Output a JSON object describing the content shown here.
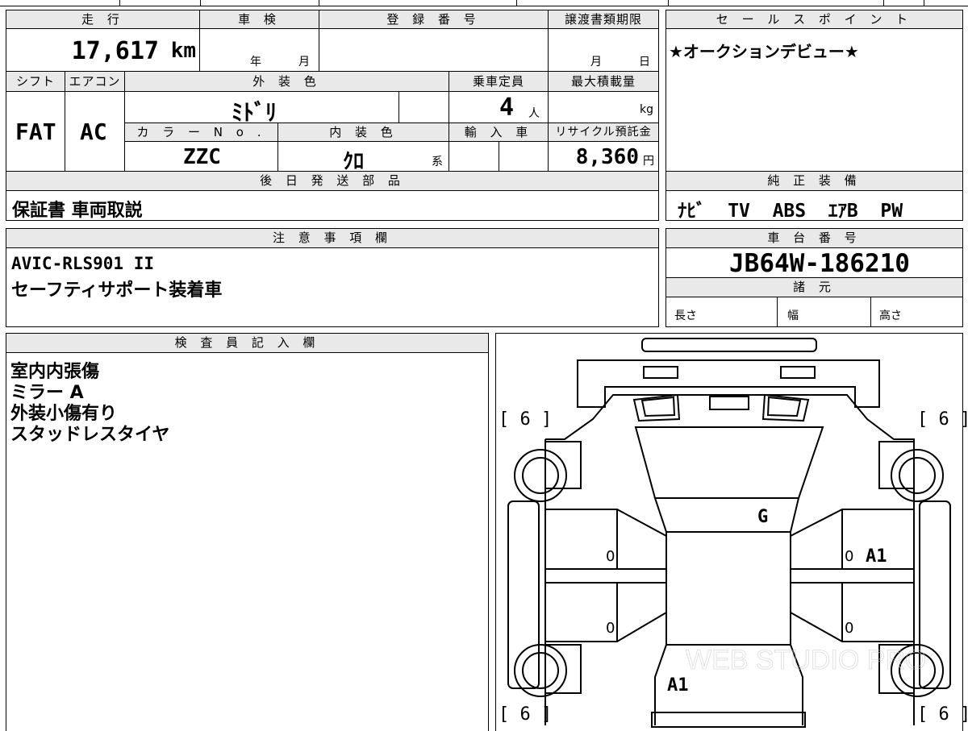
{
  "top_row": {
    "mileage_label": "走 行",
    "mileage_value": "17,617",
    "mileage_unit": "km",
    "inspection_label": "車 検",
    "inspection_year_unit": "年",
    "inspection_month_unit": "月",
    "registration_label": "登 録 番 号",
    "transfer_docs_label": "譲渡書類期限",
    "transfer_month_unit": "月",
    "transfer_day_unit": "日"
  },
  "vehicle": {
    "shift_label": "シフト",
    "shift_value": "FAT",
    "ac_label": "エアコン",
    "ac_value": "AC",
    "exterior_color_label": "外 装 色",
    "exterior_color_value": "ﾐﾄﾞﾘ",
    "capacity_label": "乗車定員",
    "capacity_value": "4",
    "capacity_unit": "人",
    "max_load_label": "最大積載量",
    "max_load_unit": "kg",
    "color_no_label": "カ ラ ー N o .",
    "color_no_value": "ZZC",
    "interior_color_label": "内 装 色",
    "interior_color_value": "ｸﾛ",
    "interior_color_suffix": "系",
    "import_label": "輸 入 車",
    "recycle_label": "リサイクル預託金",
    "recycle_value": "8,360",
    "recycle_unit": "円"
  },
  "sales_point": {
    "label": "セ ー ル ス ポ イ ン ト",
    "text": "★オークションデビュー★"
  },
  "later_parts": {
    "label": "後 日 発 送 部 品",
    "text": "保証書 車両取説"
  },
  "genuine_equipment": {
    "label": "純 正 装 備",
    "text": "ﾅﾋﾞ  TV  ABS  ｴｱB  PW"
  },
  "notes": {
    "label": "注 意 事 項 欄",
    "line1": "AVIC-RLS901 II",
    "line2": "セーフティサポート装着車"
  },
  "chassis": {
    "label": "車 台 番 号",
    "value": "JB64W-186210",
    "specs_label": "諸 元",
    "length_label": "長さ",
    "width_label": "幅",
    "height_label": "高さ"
  },
  "inspector": {
    "label": "検 査 員 記 入 欄",
    "lines": [
      "室内内張傷",
      "ミラー A",
      "外装小傷有り",
      "スタッドレスタイヤ"
    ]
  },
  "diagram": {
    "tire_tl": "[ 6 ]",
    "tire_tr": "[ 6 ]",
    "tire_bl": "[ 6 ]",
    "tire_br": "[ 6 ]",
    "windshield_mark": "G",
    "right_front_door_mark": "A1",
    "rear_mark": "A1",
    "door_zero_1": "0",
    "door_zero_2": "0",
    "door_zero_3": "0",
    "door_zero_4": "0",
    "watermark": "WEB STUDIO PRO"
  }
}
